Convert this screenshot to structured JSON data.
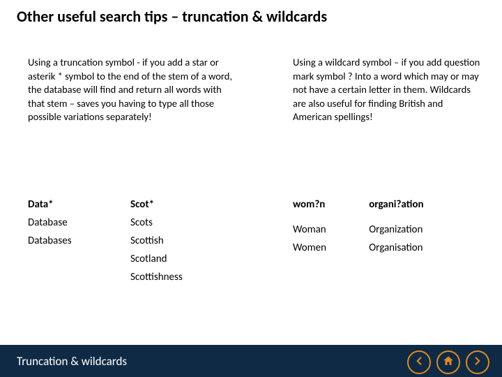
{
  "title": "Other useful search tips – truncation & wildcards",
  "left_paragraph": "Using a truncation symbol - if you add a star or asterik * symbol to the end of the stem of a word, the database will find and return all words with that stem – saves you having to type all those possible variations separately!",
  "right_paragraph": "Using a wildcard symbol – if you add question mark symbol ? Into a word which may or may not have a certain letter in them. Wildcards are also useful for finding British and American spellings!",
  "left_table": {
    "col1_head": "Data*",
    "col2_head": "Scot*",
    "rows": [
      [
        "Database",
        "Scots"
      ],
      [
        "Databases",
        "Scottish"
      ],
      [
        "",
        "Scotland"
      ],
      [
        "",
        "Scottishness"
      ]
    ]
  },
  "right_table": {
    "col1_head": "wom?n",
    "col2_head": "organi?ation",
    "rows": [
      [
        "Woman",
        "Organization"
      ],
      [
        "Women",
        "Organisation"
      ]
    ]
  },
  "footer": "Truncation & wildcards",
  "nav": {
    "prev": "prev",
    "home": "home",
    "next": "next"
  }
}
